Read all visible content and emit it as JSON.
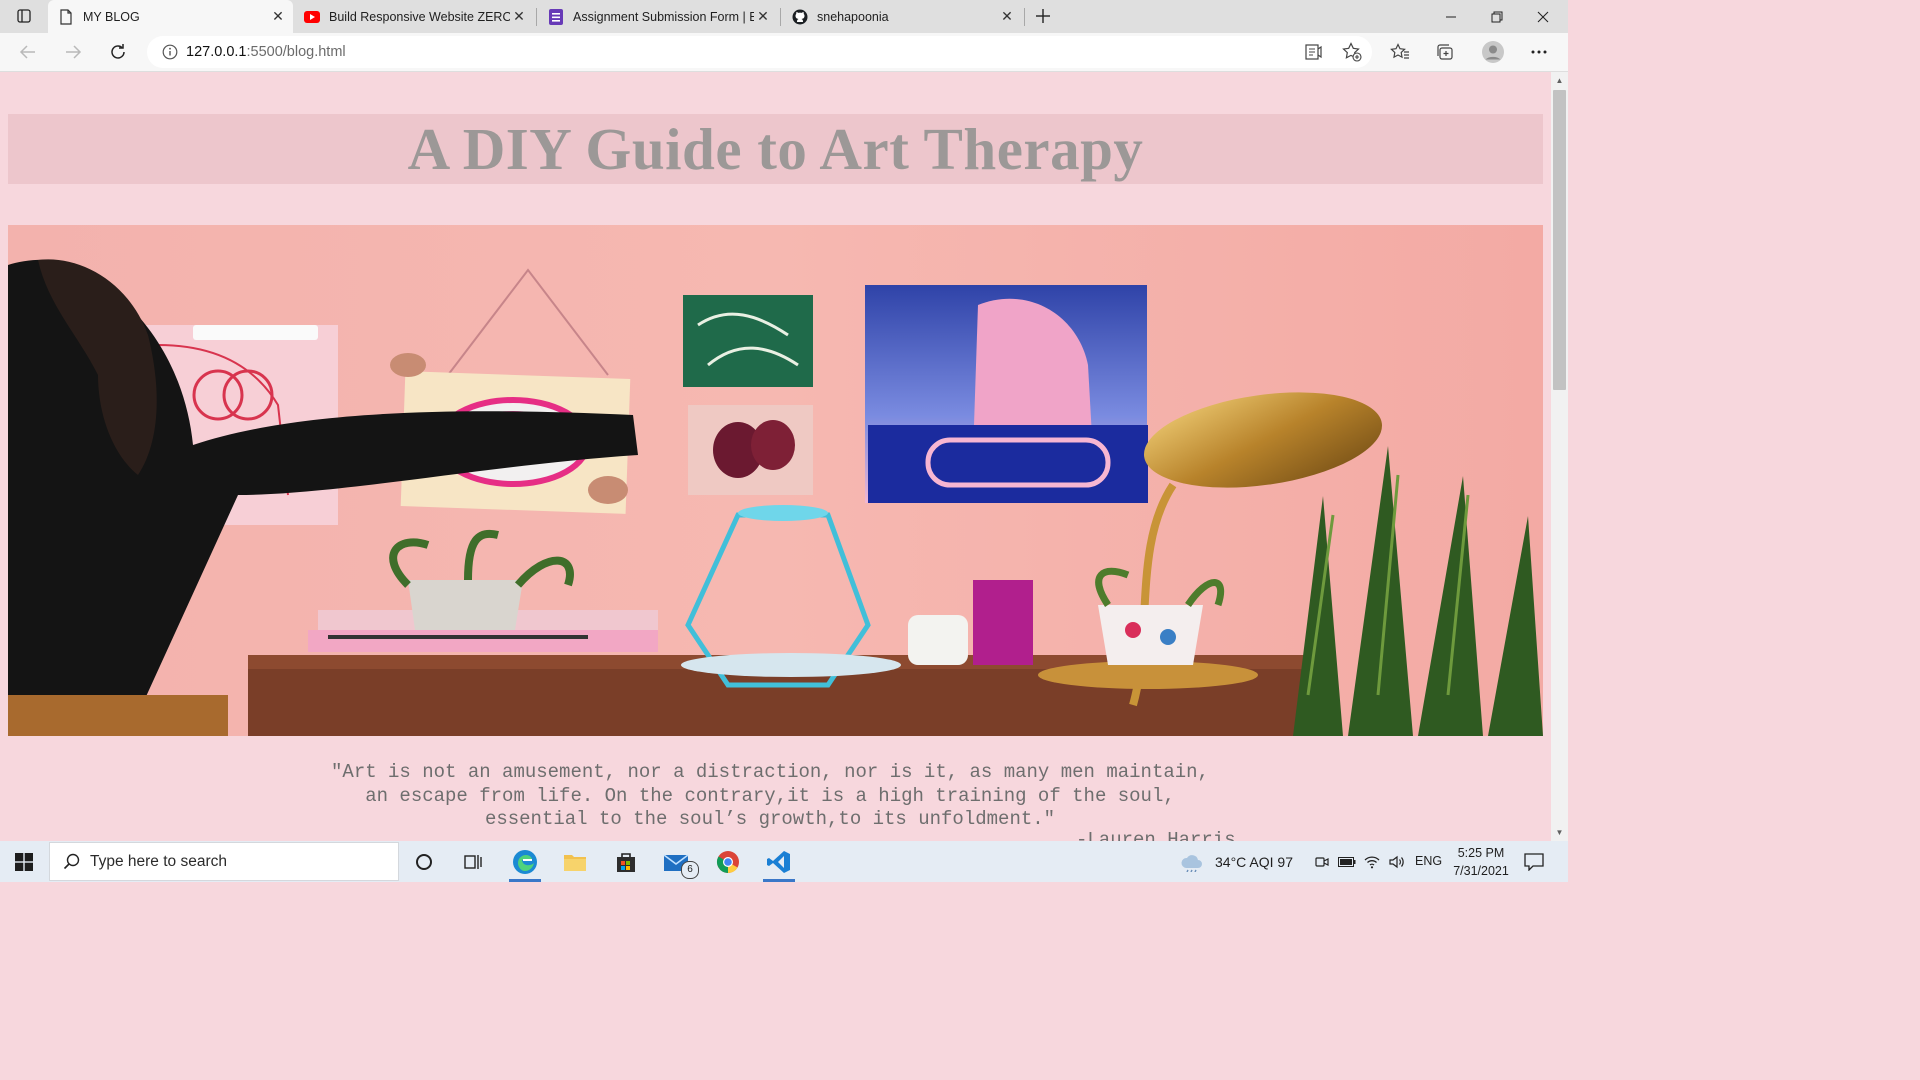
{
  "browser": {
    "tabs": [
      {
        "label": "MY BLOG",
        "icon": "page-icon",
        "active": true
      },
      {
        "label": "Build Responsive Website ZERO T",
        "icon": "youtube-icon",
        "active": false
      },
      {
        "label": "Assignment Submission Form | E",
        "icon": "forms-icon",
        "active": false
      },
      {
        "label": "snehapoonia",
        "icon": "github-icon",
        "active": false
      }
    ],
    "address": {
      "host": "127.0.0.1",
      "path": ":5500/blog.html"
    }
  },
  "page": {
    "title": "A DIY Guide to Art Therapy",
    "quote_lines": [
      "\"Art is not an amusement, nor a distraction, nor is it, as many men maintain,",
      "an escape from life. On the contrary,it is a high training of the soul,",
      "essential to the soul’s growth,to its unfoldment.\""
    ],
    "quote_author": "-Lauren Harris"
  },
  "taskbar": {
    "search_placeholder": "Type here to search",
    "mail_badge": "6",
    "weather": "34°C  AQI 97",
    "language": "ENG",
    "time": "5:25 PM",
    "date": "7/31/2021"
  },
  "colors": {
    "page_bg": "#f7d7dd",
    "title_band": "#edc6cc",
    "title_text": "#9c9897",
    "taskbar": "#e5ecf4"
  }
}
